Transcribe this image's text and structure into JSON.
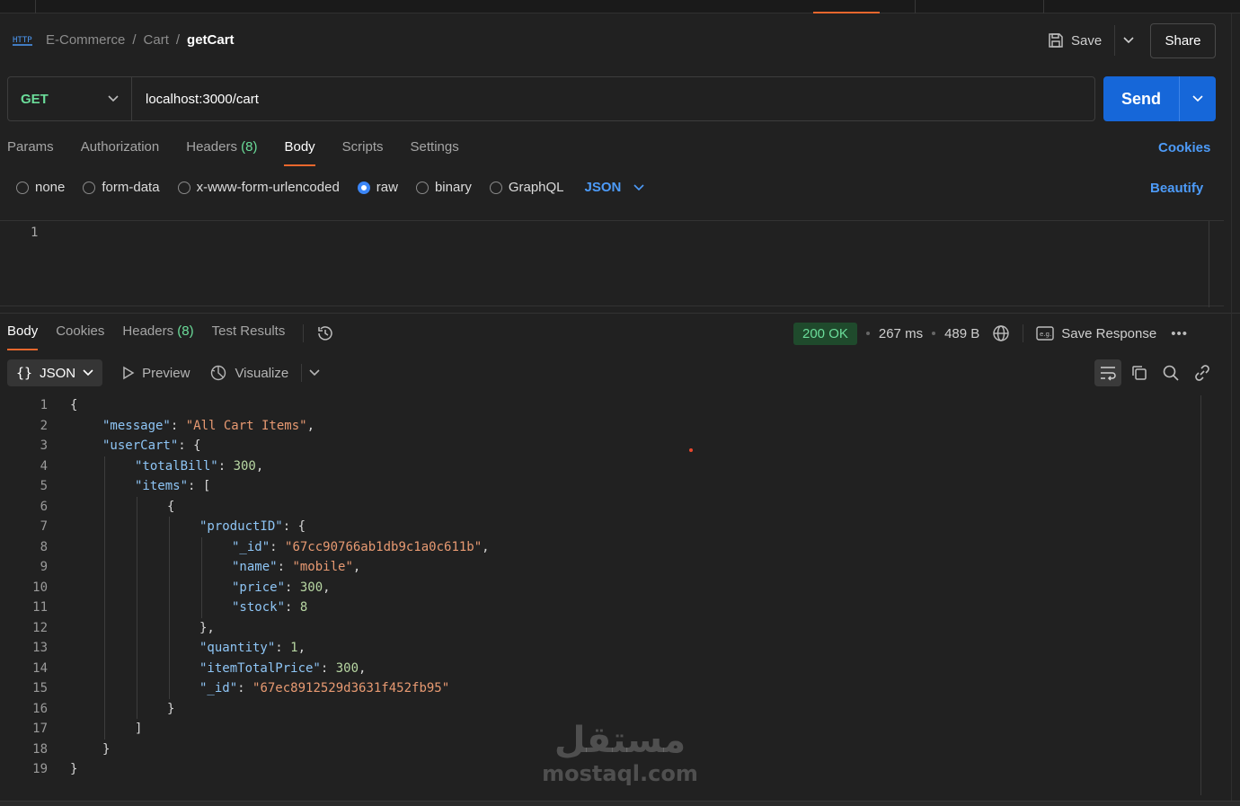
{
  "breadcrumb": {
    "items": [
      "E-Commerce",
      "Cart"
    ],
    "current": "getCart"
  },
  "header": {
    "save_label": "Save",
    "share_label": "Share"
  },
  "request": {
    "method": "GET",
    "url": "localhost:3000/cart",
    "send_label": "Send"
  },
  "request_tabs": [
    {
      "label": "Params"
    },
    {
      "label": "Authorization"
    },
    {
      "label": "Headers",
      "count": "(8)"
    },
    {
      "label": "Body",
      "active": true
    },
    {
      "label": "Scripts"
    },
    {
      "label": "Settings"
    }
  ],
  "cookies_label": "Cookies",
  "body_modes": {
    "options": [
      "none",
      "form-data",
      "x-www-form-urlencoded",
      "raw",
      "binary",
      "GraphQL"
    ],
    "selected": "raw",
    "format": "JSON",
    "beautify_label": "Beautify"
  },
  "request_editor": {
    "line_numbers": [
      "1"
    ]
  },
  "response_tabs": [
    {
      "label": "Body",
      "active": true
    },
    {
      "label": "Cookies"
    },
    {
      "label": "Headers",
      "count": "(8)"
    },
    {
      "label": "Test Results"
    }
  ],
  "response_status": {
    "status": "200 OK",
    "time": "267 ms",
    "size": "489 B",
    "save_response_label": "Save Response"
  },
  "response_toolbar": {
    "format": "JSON",
    "preview_label": "Preview",
    "visualize_label": "Visualize"
  },
  "response_body": [
    {
      "n": "1",
      "indent": 0,
      "parts": [
        [
          "p",
          "{"
        ]
      ]
    },
    {
      "n": "2",
      "indent": 1,
      "parts": [
        [
          "k",
          "\"message\""
        ],
        [
          "p",
          ": "
        ],
        [
          "s",
          "\"All Cart Items\""
        ],
        [
          "p",
          ","
        ]
      ]
    },
    {
      "n": "3",
      "indent": 1,
      "parts": [
        [
          "k",
          "\"userCart\""
        ],
        [
          "p",
          ": {"
        ]
      ]
    },
    {
      "n": "4",
      "indent": 2,
      "parts": [
        [
          "k",
          "\"totalBill\""
        ],
        [
          "p",
          ": "
        ],
        [
          "n",
          "300"
        ],
        [
          "p",
          ","
        ]
      ]
    },
    {
      "n": "5",
      "indent": 2,
      "parts": [
        [
          "k",
          "\"items\""
        ],
        [
          "p",
          ": ["
        ]
      ]
    },
    {
      "n": "6",
      "indent": 3,
      "parts": [
        [
          "p",
          "{"
        ]
      ]
    },
    {
      "n": "7",
      "indent": 4,
      "parts": [
        [
          "k",
          "\"productID\""
        ],
        [
          "p",
          ": {"
        ]
      ]
    },
    {
      "n": "8",
      "indent": 5,
      "parts": [
        [
          "k",
          "\"_id\""
        ],
        [
          "p",
          ": "
        ],
        [
          "s",
          "\"67cc90766ab1db9c1a0c611b\""
        ],
        [
          "p",
          ","
        ]
      ]
    },
    {
      "n": "9",
      "indent": 5,
      "parts": [
        [
          "k",
          "\"name\""
        ],
        [
          "p",
          ": "
        ],
        [
          "s",
          "\"mobile\""
        ],
        [
          "p",
          ","
        ]
      ]
    },
    {
      "n": "10",
      "indent": 5,
      "parts": [
        [
          "k",
          "\"price\""
        ],
        [
          "p",
          ": "
        ],
        [
          "n",
          "300"
        ],
        [
          "p",
          ","
        ]
      ]
    },
    {
      "n": "11",
      "indent": 5,
      "parts": [
        [
          "k",
          "\"stock\""
        ],
        [
          "p",
          ": "
        ],
        [
          "n",
          "8"
        ]
      ]
    },
    {
      "n": "12",
      "indent": 4,
      "parts": [
        [
          "p",
          "},"
        ]
      ]
    },
    {
      "n": "13",
      "indent": 4,
      "parts": [
        [
          "k",
          "\"quantity\""
        ],
        [
          "p",
          ": "
        ],
        [
          "n",
          "1"
        ],
        [
          "p",
          ","
        ]
      ]
    },
    {
      "n": "14",
      "indent": 4,
      "parts": [
        [
          "k",
          "\"itemTotalPrice\""
        ],
        [
          "p",
          ": "
        ],
        [
          "n",
          "300"
        ],
        [
          "p",
          ","
        ]
      ]
    },
    {
      "n": "15",
      "indent": 4,
      "parts": [
        [
          "k",
          "\"_id\""
        ],
        [
          "p",
          ": "
        ],
        [
          "s",
          "\"67ec8912529d3631f452fb95\""
        ]
      ]
    },
    {
      "n": "16",
      "indent": 3,
      "parts": [
        [
          "p",
          "}"
        ]
      ]
    },
    {
      "n": "17",
      "indent": 2,
      "parts": [
        [
          "p",
          "]"
        ]
      ]
    },
    {
      "n": "18",
      "indent": 1,
      "parts": [
        [
          "p",
          "}"
        ]
      ]
    },
    {
      "n": "19",
      "indent": 0,
      "parts": [
        [
          "p",
          "}"
        ]
      ]
    }
  ],
  "watermark": {
    "arabic": "مستقل",
    "latin": "mostaql.com"
  },
  "colors": {
    "accent_orange": "#e8672d",
    "send_blue": "#1667d9",
    "link_blue": "#4d9bf8",
    "method_green": "#6bdd9a",
    "json_key": "#8ec5f5",
    "json_string": "#e89a72",
    "json_number": "#b8d7a3"
  },
  "icons": [
    "http-icon",
    "save-icon",
    "chevron-down-icon",
    "history-icon",
    "globe-icon",
    "save-response-icon",
    "more-icon",
    "play-icon",
    "visualize-icon",
    "wrap-icon",
    "copy-icon",
    "search-icon",
    "link-icon"
  ]
}
